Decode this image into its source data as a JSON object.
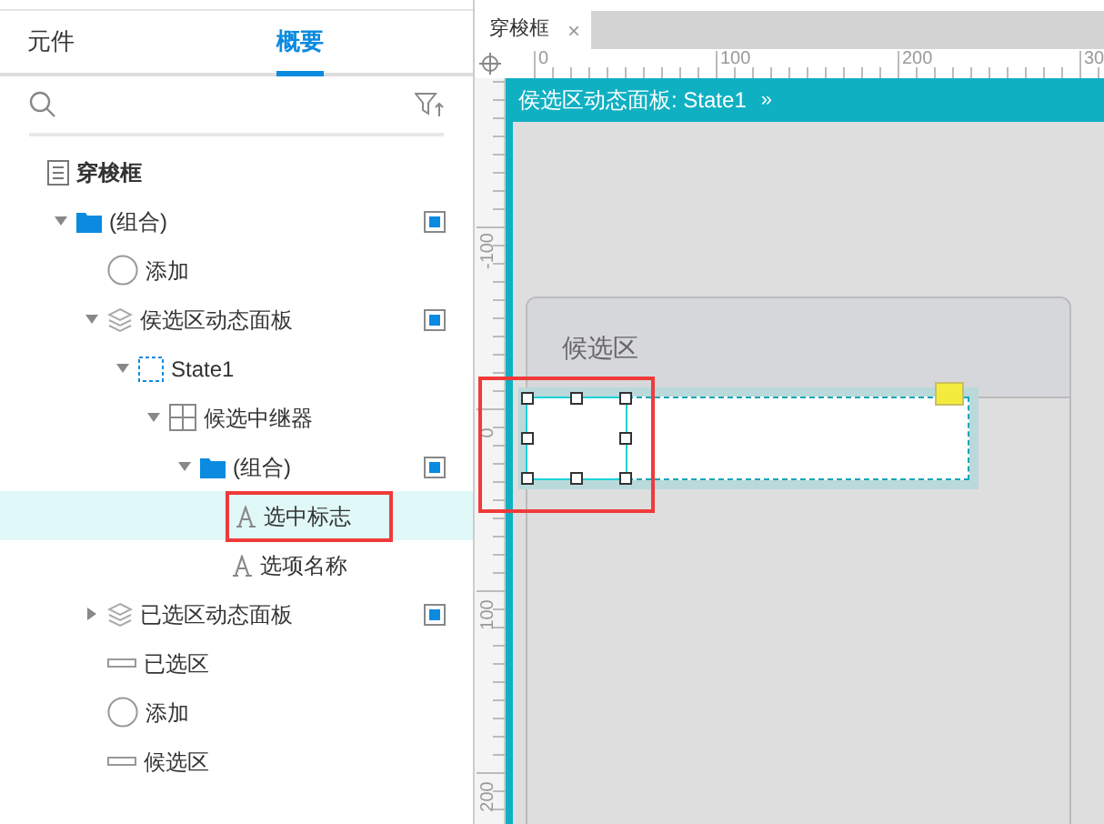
{
  "panel_tabs": [
    {
      "label": "元件",
      "selected": false
    },
    {
      "label": "概要",
      "selected": true
    }
  ],
  "outline": {
    "kind": "page",
    "label": "穿梭框",
    "selected": false,
    "children": [
      {
        "kind": "folder",
        "label": "(组合)",
        "expanded": true,
        "marked": true,
        "selected": false,
        "children": [
          {
            "kind": "circle",
            "label": "添加",
            "selected": false
          },
          {
            "kind": "layers",
            "label": "侯选区动态面板",
            "expanded": true,
            "marked": true,
            "selected": false,
            "children": [
              {
                "kind": "state",
                "label": "State1",
                "expanded": true,
                "selected": false,
                "children": [
                  {
                    "kind": "repeater",
                    "label": "候选中继器",
                    "expanded": true,
                    "selected": false,
                    "children": [
                      {
                        "kind": "folder",
                        "label": "(组合)",
                        "expanded": true,
                        "marked": true,
                        "selected": false,
                        "children": [
                          {
                            "kind": "text",
                            "label": "选中标志",
                            "selected": true
                          },
                          {
                            "kind": "text",
                            "label": "选项名称",
                            "selected": false
                          }
                        ]
                      }
                    ]
                  }
                ]
              }
            ]
          },
          {
            "kind": "layers",
            "label": "已选区动态面板",
            "expanded": false,
            "marked": true,
            "selected": false
          },
          {
            "kind": "rect",
            "label": "已选区",
            "selected": false
          },
          {
            "kind": "circle",
            "label": "添加",
            "selected": false
          },
          {
            "kind": "rect",
            "label": "候选区",
            "selected": false
          }
        ]
      }
    ]
  },
  "document_tabs": [
    {
      "label": "穿梭框",
      "close": "×",
      "selected": true
    }
  ],
  "ruler": {
    "horizontal": [
      "0",
      "100",
      "200",
      "30"
    ],
    "vertical": [
      "-100",
      "0",
      "100",
      "200"
    ]
  },
  "canvas": {
    "header": "侯选区动态面板: State1",
    "header_more": "»",
    "card_title": "候选区"
  }
}
